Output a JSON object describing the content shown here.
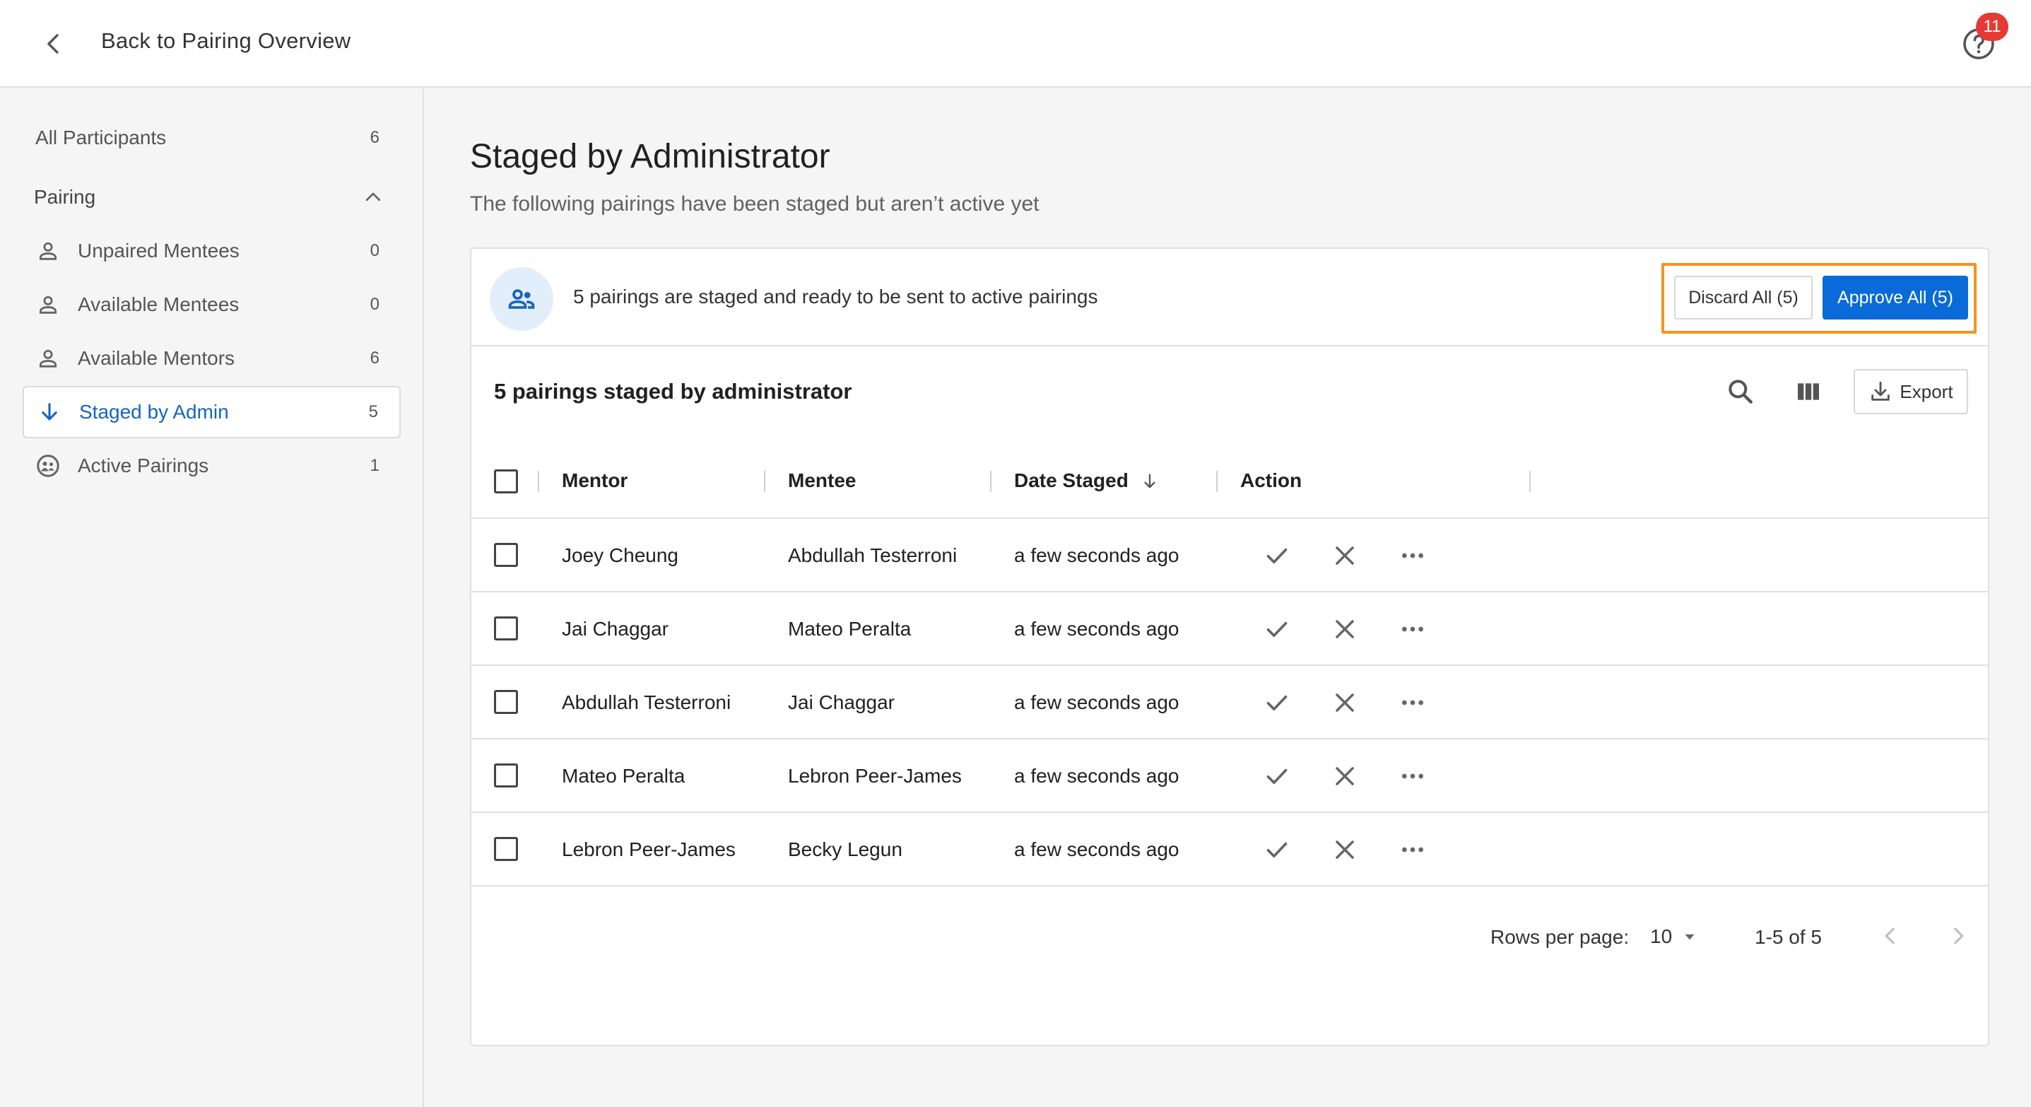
{
  "topbar": {
    "back_label": "Back to Pairing Overview",
    "help_badge": "11"
  },
  "sidebar": {
    "all_participants": {
      "label": "All Participants",
      "count": "6"
    },
    "pairing_section": "Pairing",
    "items": [
      {
        "label": "Unpaired Mentees",
        "count": "0",
        "icon": "person-icon"
      },
      {
        "label": "Available Mentees",
        "count": "0",
        "icon": "person-icon"
      },
      {
        "label": "Available Mentors",
        "count": "6",
        "icon": "person-icon"
      },
      {
        "label": "Staged by Admin",
        "count": "5",
        "icon": "arrow-down-icon"
      },
      {
        "label": "Active Pairings",
        "count": "1",
        "icon": "pairing-icon"
      }
    ]
  },
  "main": {
    "title": "Staged by Administrator",
    "subtitle": "The following pairings have been staged but aren’t active yet",
    "banner_text": "5 pairings are staged and ready to be sent to active pairings",
    "discard_label": "Discard All (5)",
    "approve_label": "Approve All (5)",
    "table_title": "5 pairings staged by administrator",
    "export_label": "Export",
    "columns": {
      "mentor": "Mentor",
      "mentee": "Mentee",
      "date": "Date Staged",
      "action": "Action"
    },
    "rows": [
      {
        "mentor": "Joey Cheung",
        "mentee": "Abdullah Testerroni",
        "date": "a few seconds ago"
      },
      {
        "mentor": "Jai Chaggar",
        "mentee": "Mateo Peralta",
        "date": "a few seconds ago"
      },
      {
        "mentor": "Abdullah Testerroni",
        "mentee": "Jai Chaggar",
        "date": "a few seconds ago"
      },
      {
        "mentor": "Mateo Peralta",
        "mentee": "Lebron Peer-James",
        "date": "a few seconds ago"
      },
      {
        "mentor": "Lebron Peer-James",
        "mentee": "Becky Legun",
        "date": "a few seconds ago"
      }
    ],
    "footer": {
      "rows_per_page_label": "Rows per page:",
      "rows_per_page": "10",
      "range": "1-5 of 5"
    }
  },
  "colors": {
    "accent": "#0a6ad8",
    "highlight": "#f7931e",
    "badge": "#e53935"
  }
}
